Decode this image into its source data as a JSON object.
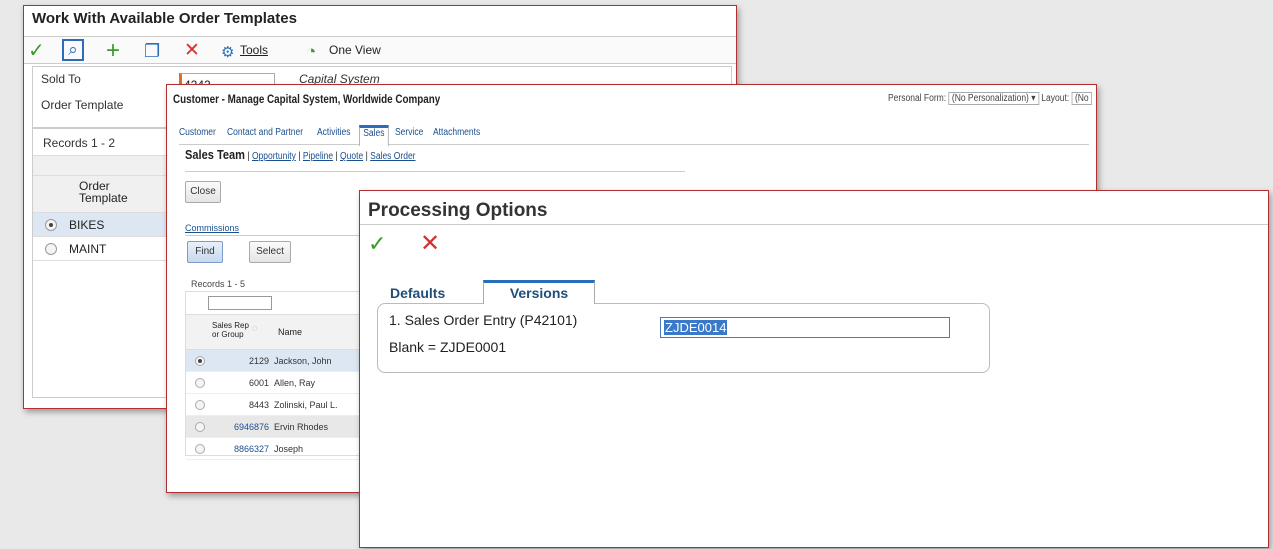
{
  "window1": {
    "title": "Work With Available Order Templates",
    "toolbar": {
      "ok_icon": "✓",
      "find_icon": "⌕",
      "add_icon": "+",
      "copy_icon": "❐",
      "delete_icon": "✕",
      "tools_icon": "⚙",
      "tools_label": "Tools",
      "oneview_icon": "◔",
      "oneview_label": "One View"
    },
    "sold_to_label": "Sold To",
    "sold_to_value": "4242",
    "sold_to_desc": "Capital System",
    "order_template_label": "Order Template",
    "records_label": "Records 1 - 2",
    "col_order_template": "Order Template",
    "rows": [
      {
        "name": "BIKES",
        "selected": true
      },
      {
        "name": "MAINT",
        "selected": false
      }
    ]
  },
  "window2": {
    "title": "Customer - Manage Capital System, Worldwide Company",
    "personal_form_label": "Personal Form:",
    "personal_form_value": "(No Personalization)",
    "layout_label": "Layout:",
    "layout_value": "(No",
    "tabs": [
      "Customer",
      "Contact and Partner",
      "Activities",
      "Sales",
      "Service",
      "Attachments"
    ],
    "active_tab": "Sales",
    "subnav_title": "Sales Team",
    "subnav_links": [
      "Opportunity",
      "Pipeline",
      "Quote",
      "Sales Order"
    ],
    "close_label": "Close",
    "commissions_label": "Commissions",
    "find_label": "Find",
    "select_label": "Select",
    "records_label": "Records 1 - 5",
    "col_sales_rep": "Sales Rep or Group",
    "col_name": "Name",
    "rows": [
      {
        "num": "2129",
        "name": "Jackson, John",
        "selected": true
      },
      {
        "num": "6001",
        "name": "Allen, Ray",
        "selected": false
      },
      {
        "num": "8443",
        "name": "Zolinski, Paul L.",
        "selected": false
      },
      {
        "num": "6946876",
        "name": "Ervin Rhodes",
        "selected": false
      },
      {
        "num": "8866327",
        "name": "Joseph",
        "selected": false
      }
    ]
  },
  "window3": {
    "title": "Processing Options",
    "ok_icon": "✓",
    "cancel_icon": "✕",
    "tab_defaults": "Defaults",
    "tab_versions": "Versions",
    "option_label": "1. Sales Order Entry (P42101)",
    "option_value": "ZJDE0014",
    "blank_note": "Blank = ZJDE0001"
  }
}
